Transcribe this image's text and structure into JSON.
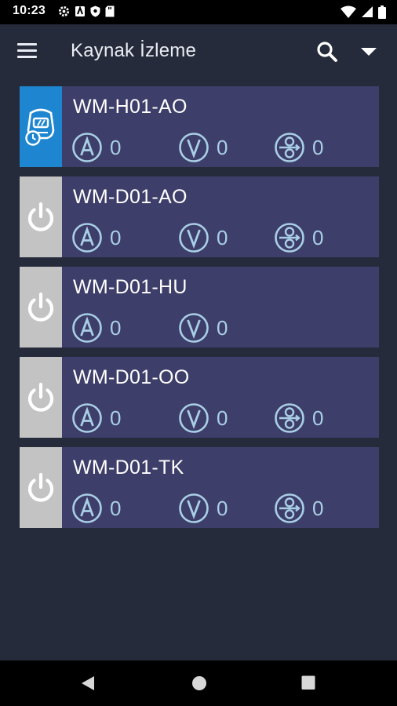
{
  "status_bar": {
    "time": "10:23"
  },
  "app_bar": {
    "title": "Kaynak İzleme"
  },
  "colors": {
    "background": "#262b3b",
    "card": "#3e3e6a",
    "active_indicator": "#1e86d0",
    "idle_indicator": "#c3c3c3",
    "metric": "#a9cfe6"
  },
  "machines": [
    {
      "name": "WM-H01-AO",
      "status": "active",
      "amps": "0",
      "volts": "0",
      "wire_feed": "0"
    },
    {
      "name": "WM-D01-AO",
      "status": "idle",
      "amps": "0",
      "volts": "0",
      "wire_feed": "0"
    },
    {
      "name": "WM-D01-HU",
      "status": "idle",
      "amps": "0",
      "volts": "0"
    },
    {
      "name": "WM-D01-OO",
      "status": "idle",
      "amps": "0",
      "volts": "0",
      "wire_feed": "0"
    },
    {
      "name": "WM-D01-TK",
      "status": "idle",
      "amps": "0",
      "volts": "0",
      "wire_feed": "0"
    }
  ]
}
